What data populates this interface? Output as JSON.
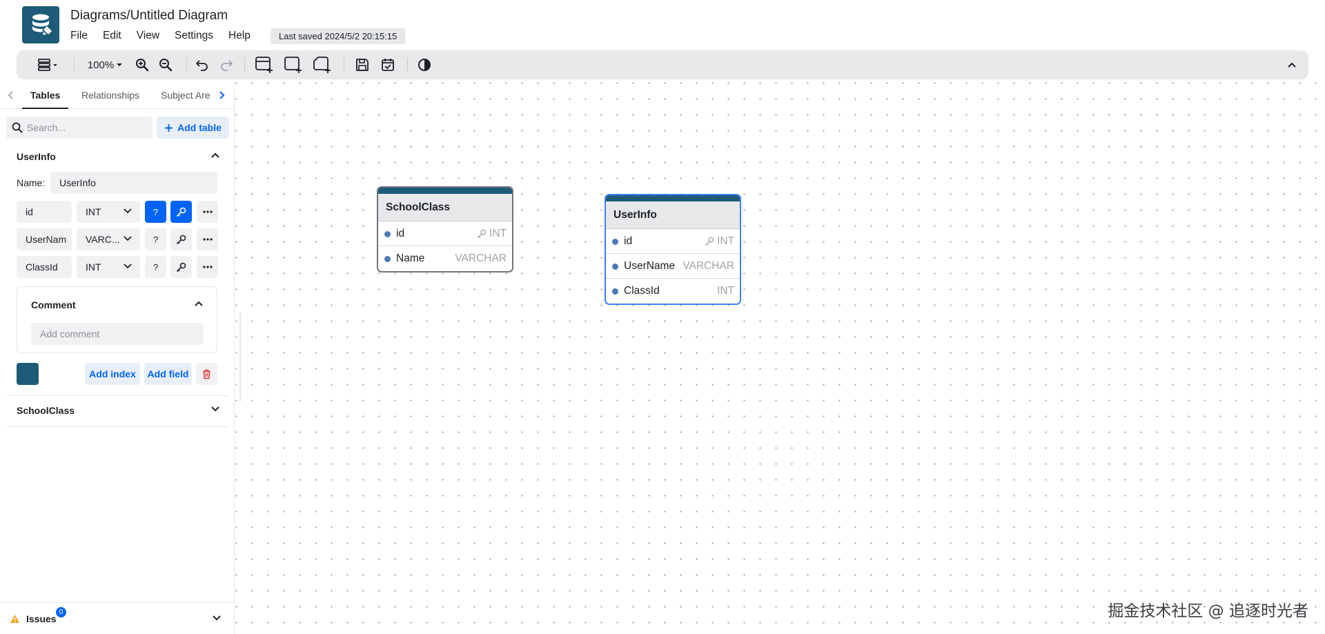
{
  "app": {
    "title": "Diagrams/Untitled Diagram",
    "menu": [
      "File",
      "Edit",
      "View",
      "Settings",
      "Help"
    ],
    "last_saved": "Last saved 2024/5/2 20:15:15"
  },
  "toolbar": {
    "zoom": "100%",
    "icons": [
      "layout-icon",
      "zoom-in-icon",
      "zoom-out-icon",
      "undo-icon",
      "redo-icon",
      "add-table-icon",
      "add-area-icon",
      "add-note-icon",
      "save-icon",
      "calendar-check-icon",
      "theme-icon",
      "collapse-icon"
    ]
  },
  "sidebar": {
    "tabs": [
      "Tables",
      "Relationships",
      "Subject Are"
    ],
    "active_tab": "Tables",
    "search_placeholder": "Search...",
    "add_table_label": "Add table",
    "tables": [
      {
        "name": "UserInfo",
        "expanded": true,
        "name_label": "Name:",
        "name_value": "UserInfo",
        "fields": [
          {
            "name": "id",
            "type": "INT",
            "nullable_active": true,
            "pk_active": true
          },
          {
            "name": "UserNam",
            "type": "VARC...",
            "nullable_active": false,
            "pk_active": false
          },
          {
            "name": "ClassId",
            "type": "INT",
            "nullable_active": false,
            "pk_active": false
          }
        ],
        "nullable_label": "?",
        "comment_label": "Comment",
        "comment_placeholder": "Add comment",
        "color": "#1d5b79",
        "add_index_label": "Add index",
        "add_field_label": "Add field"
      },
      {
        "name": "SchoolClass",
        "expanded": false
      }
    ],
    "issues_label": "Issues",
    "issues_count": "0"
  },
  "canvas": {
    "entities": [
      {
        "name": "SchoolClass",
        "selected": false,
        "header_color": "#1d5b79",
        "fields": [
          {
            "name": "id",
            "type": "INT",
            "key": true
          },
          {
            "name": "Name",
            "type": "VARCHAR",
            "key": false
          }
        ]
      },
      {
        "name": "UserInfo",
        "selected": true,
        "header_color": "#1d5b79",
        "fields": [
          {
            "name": "id",
            "type": "INT",
            "key": true
          },
          {
            "name": "UserName",
            "type": "VARCHAR",
            "key": false
          },
          {
            "name": "ClassId",
            "type": "INT",
            "key": false
          }
        ]
      }
    ]
  },
  "watermark": "掘金技术社区 @ 追逐时光者",
  "colors": {
    "accent": "#0064fa",
    "table": "#1d5b79",
    "selection": "#3b82f6"
  }
}
